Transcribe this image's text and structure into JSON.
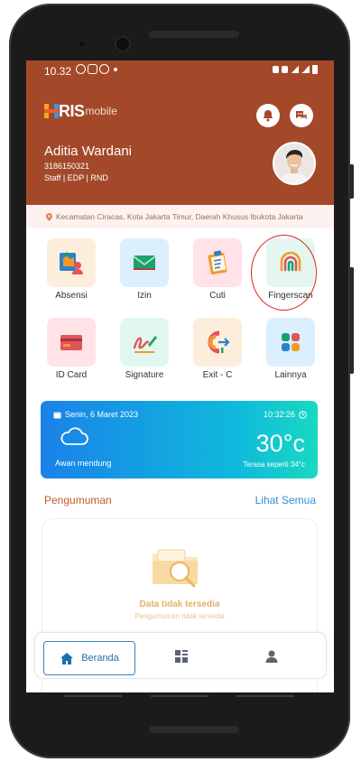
{
  "status_bar": {
    "time": "10.32"
  },
  "header": {
    "logo_text": "RIS",
    "logo_sub": "mobile",
    "user": {
      "name": "Aditia Wardani",
      "id": "3186150321",
      "role": "Staff | EDP | RND"
    },
    "colors": {
      "background": "#a3492a"
    }
  },
  "location": {
    "text": "Kecamatan Ciracas, Kota Jakarta Timur, Daerah Khusus Ibukota Jakarta"
  },
  "menu": {
    "items": [
      {
        "label": "Absensi",
        "icon": "attendance-icon",
        "bg": "#fdeedc"
      },
      {
        "label": "Izin",
        "icon": "envelope-icon",
        "bg": "#dcefff"
      },
      {
        "label": "Cuti",
        "icon": "clipboard-icon",
        "bg": "#ffe3e6"
      },
      {
        "label": "Fingerscan",
        "icon": "fingerprint-icon",
        "bg": "#e3f7f0"
      },
      {
        "label": "ID Card",
        "icon": "id-card-icon",
        "bg": "#ffe3e6"
      },
      {
        "label": "Signature",
        "icon": "signature-icon",
        "bg": "#e1f8ef"
      },
      {
        "label": "Exit - C",
        "icon": "exit-icon",
        "bg": "#fdeedc"
      },
      {
        "label": "Lainnya",
        "icon": "more-apps-icon",
        "bg": "#dcefff"
      }
    ]
  },
  "weather": {
    "date": "Senin, 6 Maret 2023",
    "time": "10:32:26",
    "temperature": "30°c",
    "condition": "Awan mendung",
    "feels_like": "Terasa seperti 34°c"
  },
  "announcements": {
    "title": "Pengumuman",
    "see_all": "Lihat Semua",
    "empty_title": "Data tidak tersedia",
    "empty_subtitle": "Pengumuman tidak tersedia"
  },
  "bottom_nav": {
    "home_label": "Beranda"
  }
}
